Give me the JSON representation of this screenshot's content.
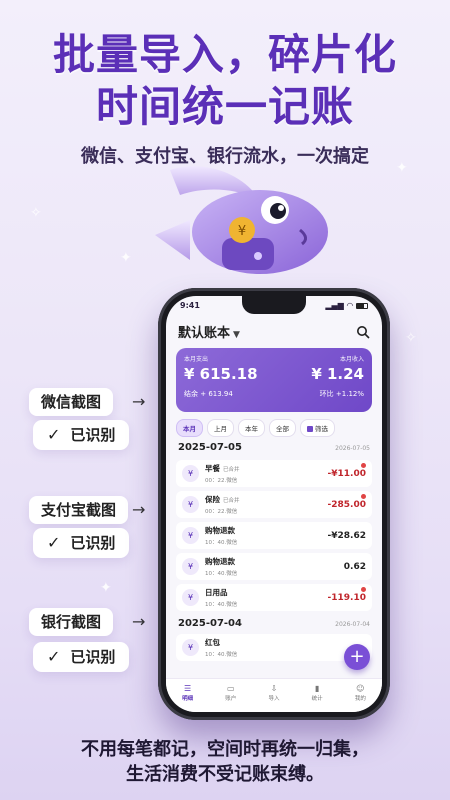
{
  "headline": {
    "line1": "批量导入，碎片化",
    "line2": "时间统一记账"
  },
  "subtitle": "微信、支付宝、银行流水，一次搞定",
  "phone": {
    "status_time": "9:41",
    "book_title": "默认账本",
    "summary": {
      "expense_label": "本月支出",
      "expense_value": "¥ 615.18",
      "income_label": "本月收入",
      "income_value": "¥ 1.24",
      "balance": "结余 + 613.94",
      "ratio": "环比 +1.12%"
    },
    "filters": [
      "本月",
      "上月",
      "本年",
      "全部",
      "筛选"
    ],
    "groups": [
      {
        "date": "2025-07-05",
        "date_right": "2026-07-05",
        "items": [
          {
            "icon": "¥",
            "name": "早餐",
            "tag": "已合并",
            "meta": "00：22.微信",
            "amount": "-¥11.00",
            "neg": true,
            "badge": true
          },
          {
            "icon": "¥",
            "name": "保险",
            "tag": "已合并",
            "meta": "00：22.微信",
            "amount": "-285.00",
            "neg": true,
            "badge": true
          },
          {
            "icon": "¥",
            "name": "购物退款",
            "tag": "",
            "meta": "10：40.微信",
            "amount": "-¥28.62",
            "neg": false,
            "badge": false
          },
          {
            "icon": "¥",
            "name": "购物退款",
            "tag": "",
            "meta": "10：40.微信",
            "amount": "0.62",
            "neg": false,
            "badge": false
          },
          {
            "icon": "¥",
            "name": "日用品",
            "tag": "",
            "meta": "10：40.微信",
            "amount": "-119.10",
            "neg": true,
            "badge": true
          }
        ]
      },
      {
        "date": "2025-07-04",
        "date_right": "2026-07-04",
        "items": [
          {
            "icon": "¥",
            "name": "红包",
            "tag": "",
            "meta": "10：40.微信",
            "amount": "",
            "neg": false,
            "badge": false
          }
        ]
      }
    ],
    "fab": "+",
    "tabs": [
      {
        "icon": "☰",
        "label": "明细"
      },
      {
        "icon": "▭",
        "label": "账户"
      },
      {
        "icon": "⇩",
        "label": "导入"
      },
      {
        "icon": "▮",
        "label": "统计"
      },
      {
        "icon": "☺",
        "label": "我的"
      }
    ]
  },
  "callouts": [
    {
      "label": "微信截图",
      "status": "已识别"
    },
    {
      "label": "支付宝截图",
      "status": "已识别"
    },
    {
      "label": "银行截图",
      "status": "已识别"
    }
  ],
  "footer": {
    "line1": "不用每笔都记，空间时再统一归集，",
    "line2": "生活消费不受记账束缚。"
  },
  "colors": {
    "accent": "#6f48c8",
    "headline": "#5b2fb7",
    "negative": "#c0262c"
  }
}
